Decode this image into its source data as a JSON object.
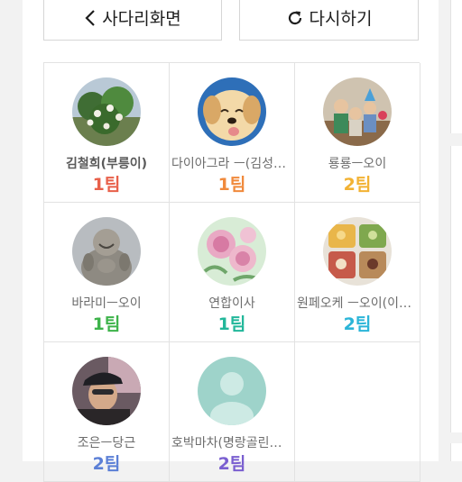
{
  "toolbar": {
    "back_label": "사다리화면",
    "retry_label": "다시하기",
    "back_icon": "chevron-left-icon",
    "retry_icon": "refresh-icon"
  },
  "members": [
    {
      "name": "김철희(부릉이)",
      "team": "1팀",
      "team_color": "#e8604a"
    },
    {
      "name": "다이아그라 ㅡ(김성용...",
      "team": "1팀",
      "team_color": "#f08a3c"
    },
    {
      "name": "룡룡ㅡ오이",
      "team": "2팀",
      "team_color": "#f2b233"
    },
    {
      "name": "바라미ㅡ오이",
      "team": "1팀",
      "team_color": "#3db34a"
    },
    {
      "name": "연합이사",
      "team": "1팀",
      "team_color": "#22b79a"
    },
    {
      "name": "원페오케 ㅡ오이(이수...",
      "team": "2팀",
      "team_color": "#2bb5d8"
    },
    {
      "name": "조은ㅡ당근",
      "team": "2팀",
      "team_color": "#5b7fd6"
    },
    {
      "name": "호박마차(명랑골린이...",
      "team": "2팀",
      "team_color": "#7a5fd0"
    }
  ]
}
